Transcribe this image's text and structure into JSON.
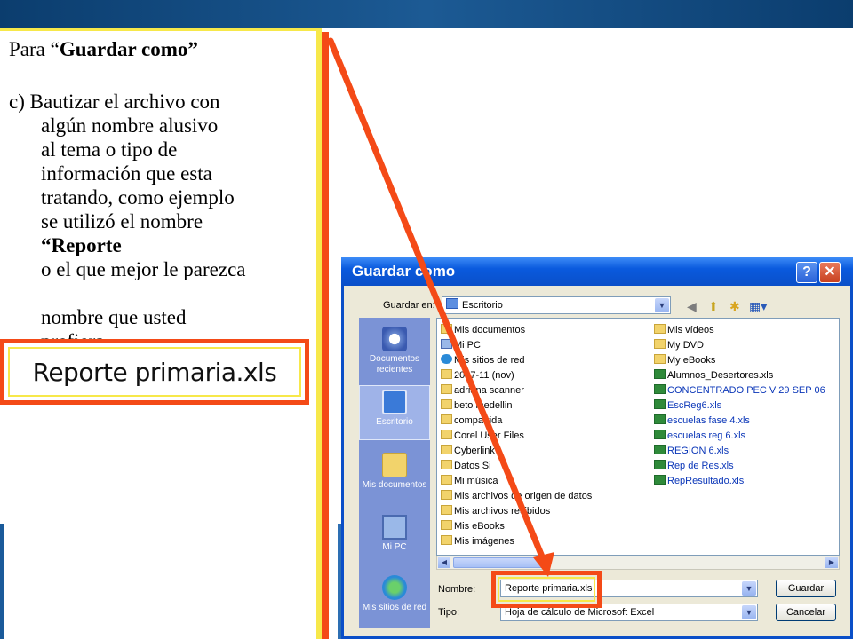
{
  "slide": {
    "heading_prefix": "Para “",
    "heading_bold": "Guardar como”",
    "step_intro": "c) Bautizar el archivo con",
    "lines": [
      "algún nombre alusivo",
      "al tema o tipo de",
      "información que esta",
      "tratando, como ejemplo",
      "se utilizó el nombre"
    ],
    "bold_line": "“Reporte",
    "partial_line": "o el que mejor le parezca",
    "tail_lines": [
      "nombre que usted",
      "prefiera"
    ],
    "callout_text": "Reporte primaria.xls"
  },
  "dialog": {
    "title": "Guardar como",
    "help_label": "?",
    "close_label": "✕",
    "save_in_label": "Guardar en:",
    "save_in_value": "Escritorio",
    "places": [
      {
        "label": "Documentos recientes",
        "icon": "recent-documents-icon"
      },
      {
        "label": "Escritorio",
        "icon": "desktop-icon"
      },
      {
        "label": "Mis documentos",
        "icon": "my-documents-icon"
      },
      {
        "label": "Mi PC",
        "icon": "my-computer-icon"
      },
      {
        "label": "Mis sitios de red",
        "icon": "network-places-icon"
      }
    ],
    "files_col1": [
      "Mis documentos",
      "Mi PC",
      "Mis sitios de red",
      "2007-11 (nov)",
      "adriana scanner",
      "beto medellin",
      "compartida",
      "Corel User Files",
      "Cyberlink",
      "Datos Si",
      "Mi música",
      "Mis archivos de origen de datos",
      "Mis archivos recibidos",
      "Mis eBooks",
      "Mis imágenes"
    ],
    "files_col2": [
      "Mis vídeos",
      "My DVD",
      "My eBooks",
      "Alumnos_Desertores.xls",
      "CONCENTRADO PEC V  29 SEP 06",
      "EscReg6.xls",
      "escuelas fase 4.xls",
      "escuelas reg 6.xls",
      "REGION 6.xls",
      "Rep de Res.xls",
      "RepResultado.xls"
    ],
    "name_label": "Nombre:",
    "name_value": "Reporte primaria.xls",
    "type_label": "Tipo:",
    "type_value": "Hoja de cálculo de Microsoft Excel",
    "save_button": "Guardar",
    "cancel_button": "Cancelar"
  },
  "colors": {
    "accent_red": "#f44a17",
    "accent_yellow": "#f7e84a",
    "title_blue": "#0a4fc8"
  }
}
